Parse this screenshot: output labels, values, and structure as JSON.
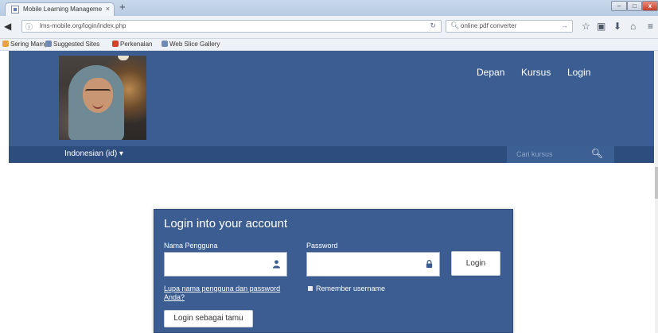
{
  "browser": {
    "tab_title": "Mobile Learning Manageme",
    "tab_close": "×",
    "new_tab": "+",
    "url": "lms-mobile.org/login/index.php",
    "search_text": "online pdf converter",
    "window_controls": {
      "minimize": "–",
      "maximize": "□",
      "close": "x"
    }
  },
  "bookmarks": [
    {
      "label": "Sering Mampir",
      "icon": "bookmark-icon",
      "color": "#e8a33a"
    },
    {
      "label": "Suggested Sites",
      "icon": "gear-icon",
      "color": "#6f8bb5"
    },
    {
      "label": "Perkenalan",
      "icon": "favicon-icon",
      "color": "#d0442c"
    },
    {
      "label": "Web Slice Gallery",
      "icon": "gear-icon",
      "color": "#6f8bb5"
    }
  ],
  "site": {
    "nav": [
      "Depan",
      "Kursus",
      "Login"
    ],
    "language": "Indonesian (id) ▾",
    "search_placeholder": "Cari kursus",
    "colors": {
      "header": "#3c5d91",
      "subbar": "#2d4d7f"
    }
  },
  "login": {
    "title": "Login into your account",
    "username_label": "Nama Pengguna",
    "password_label": "Password",
    "login_button": "Login",
    "forgot_link": "Lupa nama pengguna dan password Anda?",
    "remember_label": "Remember username",
    "guest_button": "Login sebagai tamu"
  }
}
